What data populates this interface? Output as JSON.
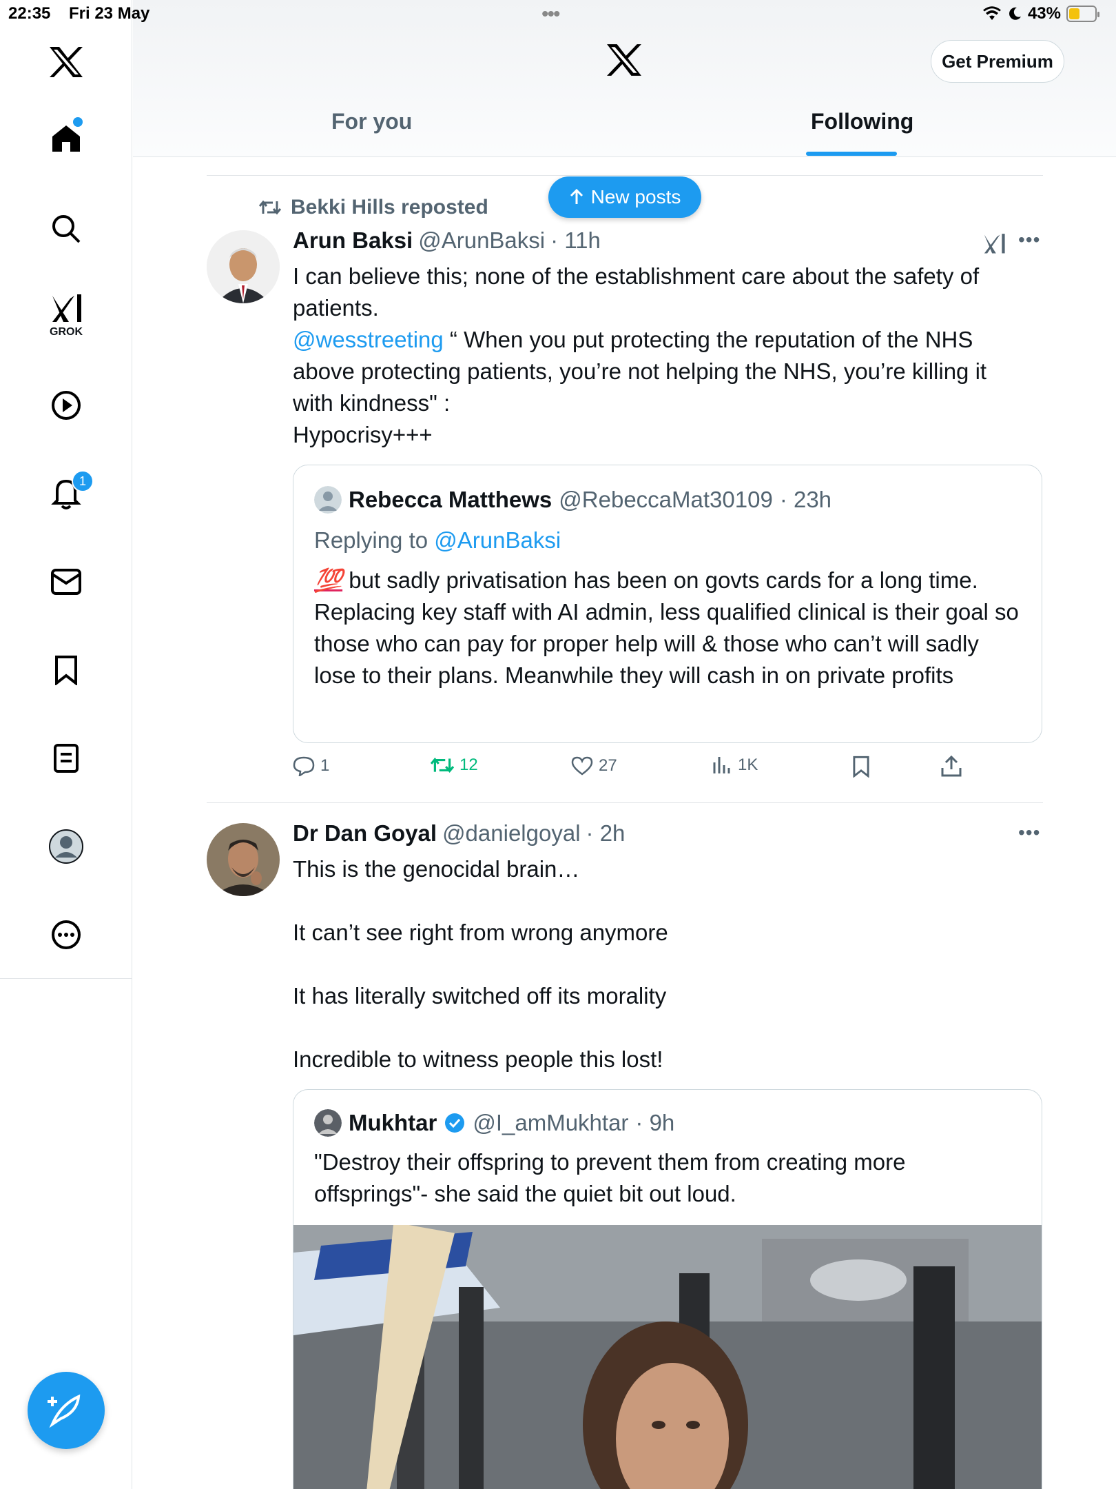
{
  "status_bar": {
    "time": "22:35",
    "date": "Fri 23 May",
    "battery": "43%"
  },
  "sidebar": {
    "items": [
      {
        "name": "home",
        "icon": "home-icon"
      },
      {
        "name": "search",
        "icon": "search-icon"
      },
      {
        "name": "grok",
        "icon": "grok-icon",
        "label": "GROK"
      },
      {
        "name": "video",
        "icon": "play-icon"
      },
      {
        "name": "notifications",
        "icon": "bell-icon",
        "badge": "1"
      },
      {
        "name": "messages",
        "icon": "mail-icon"
      },
      {
        "name": "bookmarks",
        "icon": "bookmark-icon"
      },
      {
        "name": "lists",
        "icon": "list-icon"
      },
      {
        "name": "profile",
        "icon": "avatar-icon"
      },
      {
        "name": "more",
        "icon": "more-icon"
      }
    ],
    "compose": "compose-icon"
  },
  "header": {
    "premium_label": "Get Premium",
    "tabs": [
      {
        "label": "For you",
        "active": false
      },
      {
        "label": "Following",
        "active": true
      }
    ]
  },
  "new_posts": {
    "label": "New posts"
  },
  "posts": [
    {
      "repost_by": "Bekki Hills reposted",
      "author": "Arun Baksi",
      "handle": "@ArunBaksi",
      "time": "· 11h",
      "text_lines": [
        "I can believe this; none of the establishment care about the safety of",
        "patients."
      ],
      "mention": "@wesstreeting",
      "text_after_mention": " “ When you put protecting the reputation of the NHS above protecting patients, you’re not helping the NHS, you’re killing it with kindness\" :",
      "text_last": "Hypocrisy+++",
      "quote": {
        "author": "Rebecca Matthews",
        "handle": "@RebeccaMat30109",
        "time": "· 23h",
        "replying_prefix": "Replying to ",
        "replying_to": "@ArunBaksi",
        "emoji": "💯",
        "text": " but sadly privatisation has been on govts cards for a long time. Replacing key staff with AI admin, less qualified clinical is their goal so those who can pay for proper help will & those who can’t will sadly lose to their plans. Meanwhile they will cash in on private profits"
      },
      "actions": {
        "replies": "1",
        "reposts": "12",
        "likes": "27",
        "views": "1K"
      }
    },
    {
      "author": "Dr Dan Goyal",
      "handle": "@danielgoyal",
      "time": "· 2h",
      "paragraphs": [
        "This is the genocidal brain…",
        "It can’t see right from wrong anymore",
        "It has literally switched off its morality",
        "Incredible to witness people this lost!"
      ],
      "quote": {
        "author": "Mukhtar",
        "handle": "@I_amMukhtar",
        "time": "· 9h",
        "text": "\"Destroy their offspring to prevent them from creating more offsprings\"- she said the quiet bit out loud."
      }
    }
  ],
  "colors": {
    "accent": "#1d9bf0",
    "repost_green": "#00ba7c",
    "muted": "#536471"
  }
}
